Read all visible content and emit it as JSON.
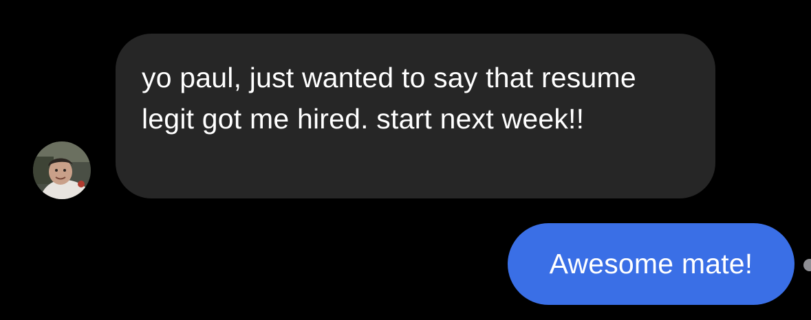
{
  "conversation": {
    "received_message": {
      "text": "yo paul, just wanted to say that resume legit got me hired. start next week!!",
      "avatar_icon": "user-avatar"
    },
    "sent_message": {
      "text": "Awesome mate!"
    }
  },
  "colors": {
    "background": "#000000",
    "received_bubble": "#262626",
    "sent_bubble": "#3a6fe6",
    "text": "#ffffff"
  }
}
